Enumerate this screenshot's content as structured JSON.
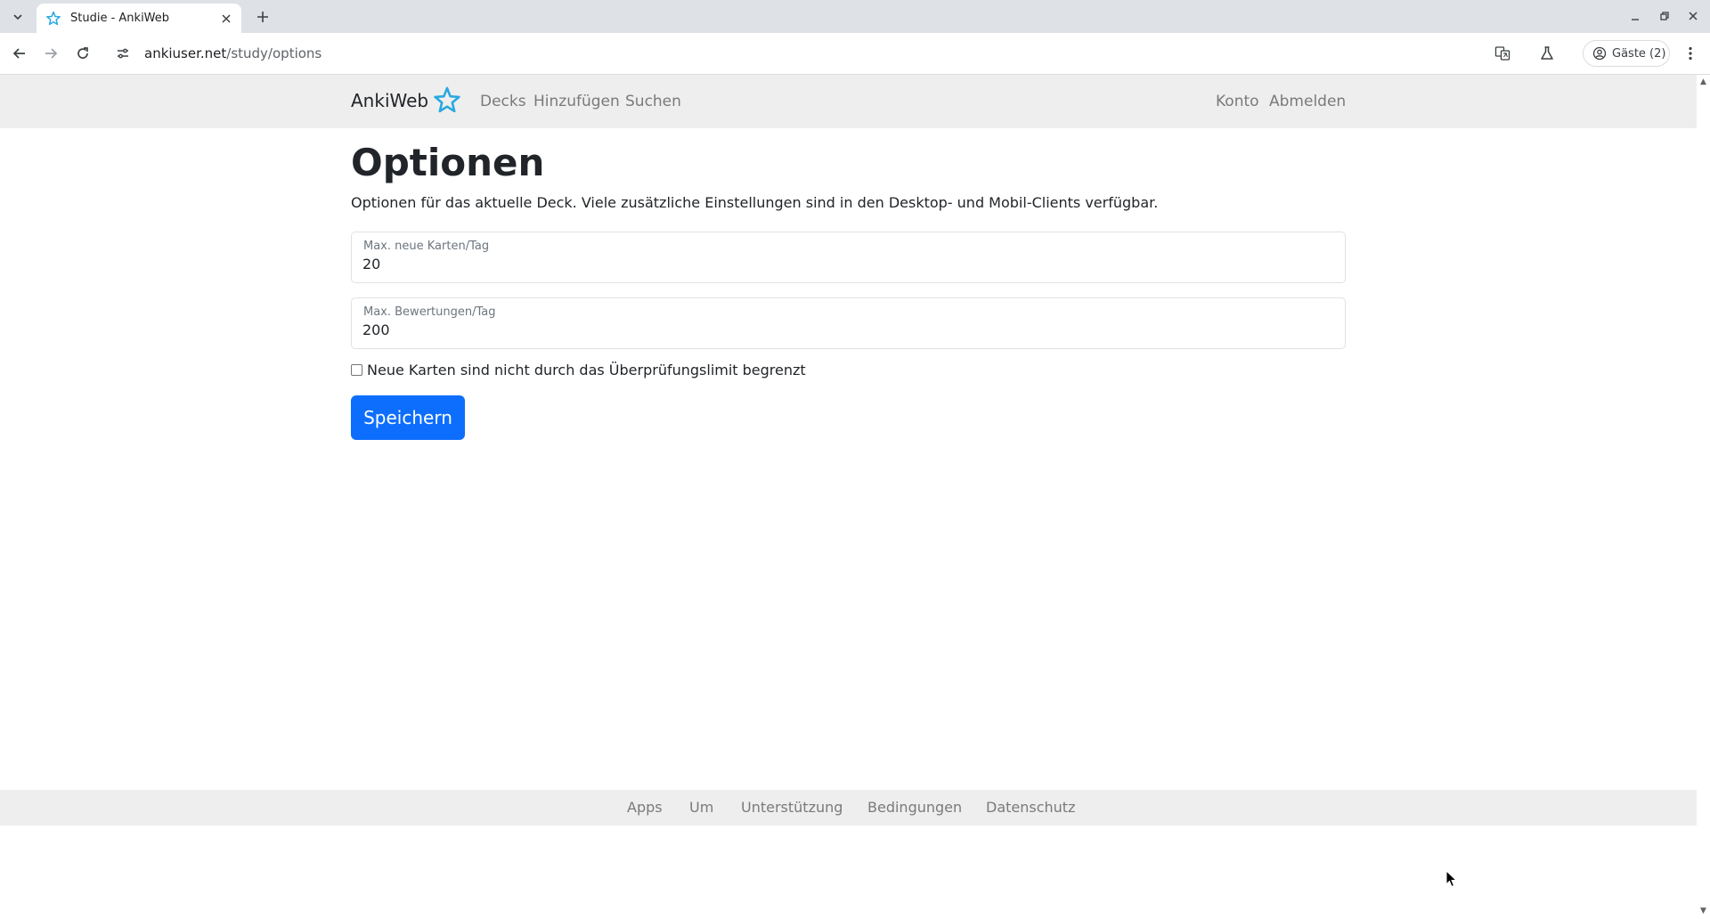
{
  "browser": {
    "tab_title": "Studie - AnkiWeb",
    "url_host": "ankiuser.net",
    "url_path": "/study/options",
    "profile_label": "Gäste (2)",
    "icons": [
      "tab-list-icon",
      "anki-star-icon",
      "close-icon",
      "plus-icon",
      "minimize-icon",
      "restore-icon",
      "close-window-icon",
      "back-icon",
      "forward-icon",
      "reload-icon",
      "site-info-icon",
      "translate-icon",
      "labs-icon",
      "profile-icon",
      "more-menu-icon"
    ]
  },
  "navbar": {
    "brand": "AnkiWeb",
    "links": [
      "Decks",
      "Hinzufügen",
      "Suchen"
    ],
    "right_links": [
      "Konto",
      "Abmelden"
    ]
  },
  "main": {
    "title": "Optionen",
    "intro": "Optionen für das aktuelle Deck. Viele zusätzliche Einstellungen sind in den Desktop- und Mobil-Clients verfügbar.",
    "new_cards_label": "Max. neue Karten/Tag",
    "new_cards_value": "20",
    "reviews_label": "Max. Bewertungen/Tag",
    "reviews_value": "200",
    "checkbox_label": "Neue Karten sind nicht durch das Überprüfungslimit begrenzt",
    "checkbox_checked": false,
    "save_label": "Speichern"
  },
  "footer": {
    "links": [
      "Apps",
      "Um",
      "Unterstützung",
      "Bedingungen",
      "Datenschutz"
    ]
  },
  "colors": {
    "accent": "#0d6efd",
    "star": "#29a8e0",
    "navbar_bg": "#eeeeee"
  }
}
